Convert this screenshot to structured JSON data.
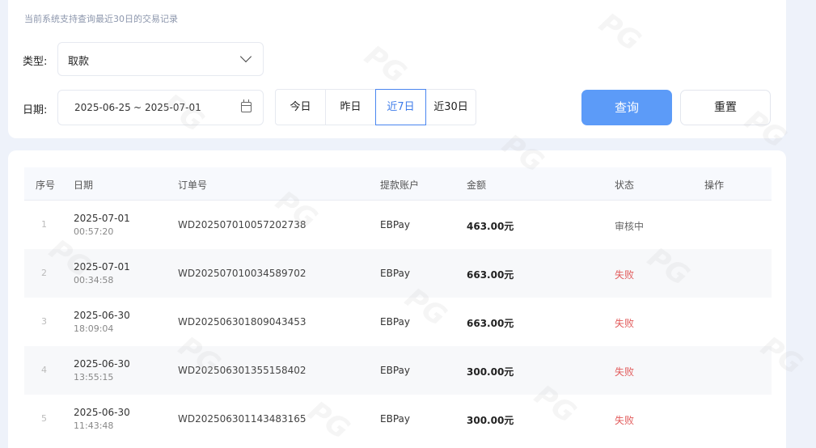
{
  "filter": {
    "hint_prefix": "当前系统支持查询最近",
    "hint_num": "30",
    "hint_suffix": "日的交易记录",
    "type_label": "类型:",
    "type_value": "取款",
    "date_label": "日期:",
    "date_start": "2025-06-25",
    "date_sep": "~",
    "date_end": "2025-07-01",
    "quick": [
      "今日",
      "昨日",
      "近7日",
      "近30日"
    ],
    "quick_active": "近7日",
    "query_label": "查询",
    "reset_label": "重置"
  },
  "table": {
    "headers": [
      "序号",
      "日期",
      "订单号",
      "提款账户",
      "金额",
      "状态",
      "操作"
    ],
    "rows": [
      {
        "idx": "1",
        "date": "2025-07-01",
        "time": "00:57:20",
        "order": "WD202507010057202738",
        "account": "EBPay",
        "amount": "463.00元",
        "status": "审核中",
        "status_kind": "pending"
      },
      {
        "idx": "2",
        "date": "2025-07-01",
        "time": "00:34:58",
        "order": "WD202507010034589702",
        "account": "EBPay",
        "amount": "663.00元",
        "status": "失败",
        "status_kind": "fail"
      },
      {
        "idx": "3",
        "date": "2025-06-30",
        "time": "18:09:04",
        "order": "WD202506301809043453",
        "account": "EBPay",
        "amount": "663.00元",
        "status": "失败",
        "status_kind": "fail"
      },
      {
        "idx": "4",
        "date": "2025-06-30",
        "time": "13:55:15",
        "order": "WD202506301355158402",
        "account": "EBPay",
        "amount": "300.00元",
        "status": "失败",
        "status_kind": "fail"
      },
      {
        "idx": "5",
        "date": "2025-06-30",
        "time": "11:43:48",
        "order": "WD202506301143483165",
        "account": "EBPay",
        "amount": "300.00元",
        "status": "失败",
        "status_kind": "fail"
      }
    ]
  },
  "watermark": "PG",
  "colors": {
    "accent": "#5c9bf8",
    "fail": "#e25c5c",
    "background": "#eef2fa"
  }
}
